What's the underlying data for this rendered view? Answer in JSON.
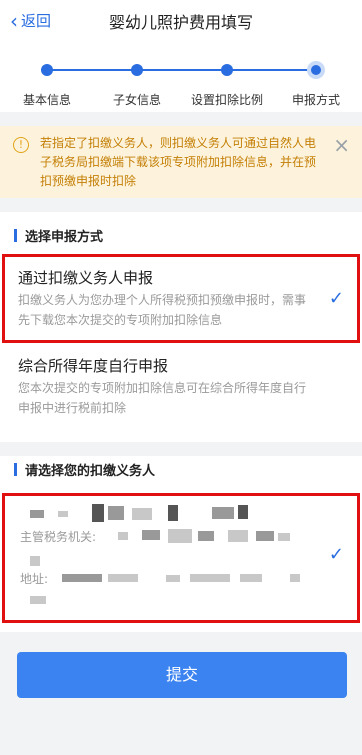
{
  "header": {
    "back_label": "返回",
    "title": "婴幼儿照护费用填写"
  },
  "steps": [
    {
      "label": "基本信息"
    },
    {
      "label": "子女信息"
    },
    {
      "label": "设置扣除比例"
    },
    {
      "label": "申报方式",
      "active": true
    }
  ],
  "notice": {
    "text": "若指定了扣缴义务人，则扣缴义务人可通过自然人电子税务局扣缴端下载该项专项附加扣除信息，并在预扣预缴申报时扣除"
  },
  "method_section": {
    "heading": "选择申报方式",
    "options": [
      {
        "title": "通过扣缴义务人申报",
        "desc": "扣缴义务人为您办理个人所得税预扣预缴申报时，需事先下载您本次提交的专项附加扣除信息",
        "selected": true
      },
      {
        "title": "综合所得年度自行申报",
        "desc": "您本次提交的专项附加扣除信息可在综合所得年度自行申报中进行税前扣除",
        "selected": false
      }
    ]
  },
  "withholder_section": {
    "heading": "请选择您的扣缴义务人",
    "tax_office_label": "主管税务机关:",
    "address_label": "地址:"
  },
  "submit_label": "提交",
  "colors": {
    "accent": "#2a6de0",
    "warning_bg": "#fdf3dc",
    "highlight_box": "#e01010"
  }
}
